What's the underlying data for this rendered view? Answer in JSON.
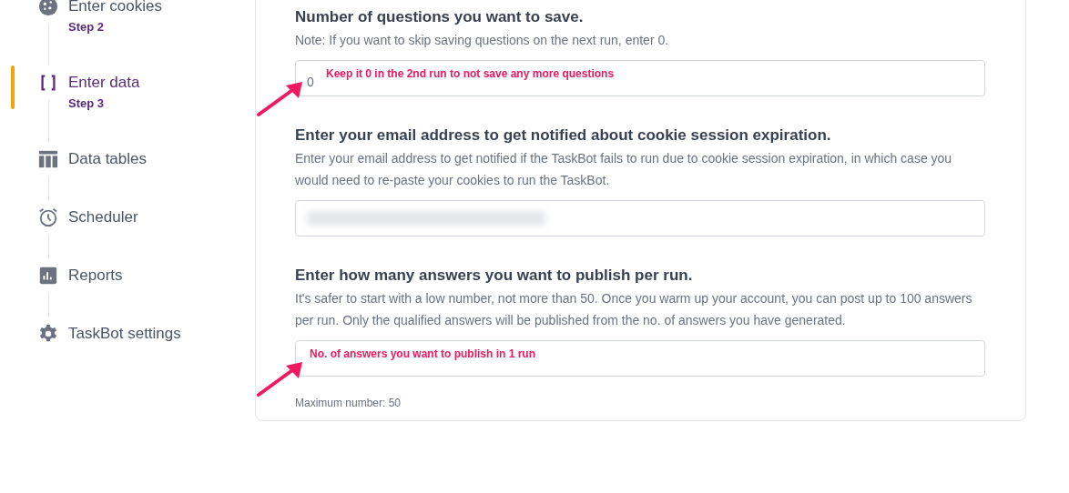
{
  "sidebar": {
    "items": [
      {
        "label": "Enter cookies",
        "step": "Step 2",
        "selected": false
      },
      {
        "label": "Enter data",
        "step": "Step 3",
        "selected": true
      },
      {
        "label": "Data tables",
        "selected": false
      },
      {
        "label": "Scheduler",
        "selected": false
      },
      {
        "label": "Reports",
        "selected": false
      },
      {
        "label": "TaskBot settings",
        "selected": false
      }
    ]
  },
  "form": {
    "sections": [
      {
        "title": "Number of questions you want to save.",
        "description": "Note: If you want to skip saving questions on the next run, enter 0.",
        "field": {
          "value": "0",
          "redacted": false
        },
        "annotation": "Keep it 0 in the 2nd run to not save any more questions"
      },
      {
        "title": "Enter your email address to get notified about cookie session expiration.",
        "description": "Enter your email address to get notified if the TaskBot fails to run due to cookie session expiration, in which case you would need to re-paste your cookies to run the TaskBot.",
        "field": {
          "redacted": true
        }
      },
      {
        "title": "Enter how many answers you want to publish per run.",
        "description": "It's safer to start with a low number, not more than 50. Once you warm up your account, you can post up to 100 answers per run.  Only the qualified answers will be published from the no. of answers you have generated.",
        "field": {
          "redacted": false
        },
        "annotation": "No. of answers you want to publish in 1 run",
        "hint": "Maximum number: 50"
      }
    ]
  }
}
